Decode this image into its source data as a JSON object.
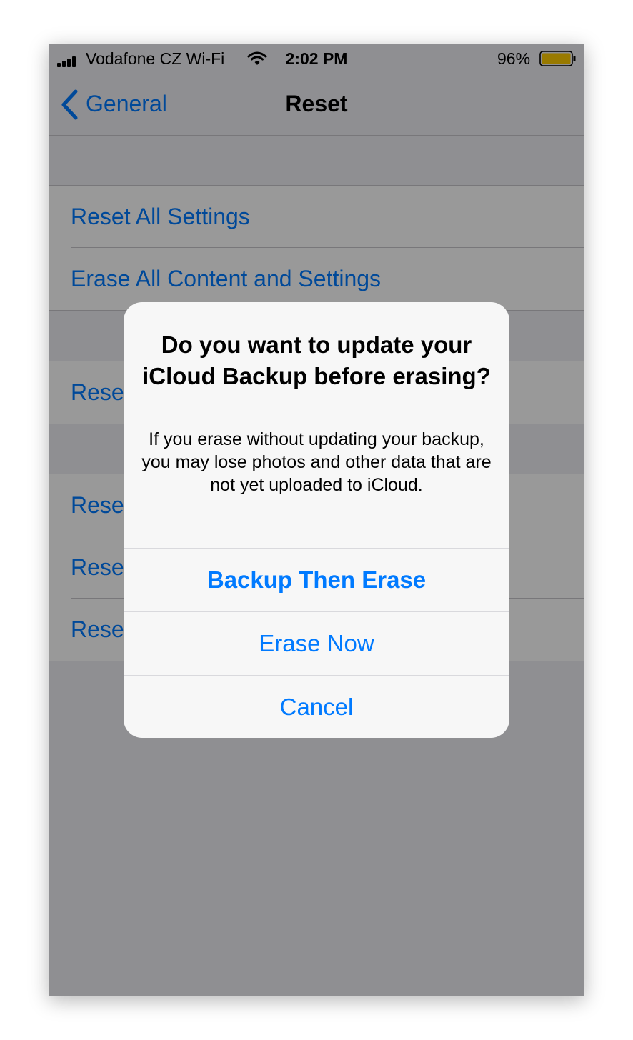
{
  "status_bar": {
    "carrier": "Vodafone CZ Wi-Fi",
    "time": "2:02 PM",
    "battery_percent": "96%",
    "signal_icon": "signal-bars-icon",
    "wifi_icon": "wifi-icon",
    "battery_icon": "battery-icon",
    "battery_color": "#ffcc00"
  },
  "nav": {
    "back_label": "General",
    "back_icon": "chevron-left-icon",
    "title": "Reset"
  },
  "list": {
    "group1": [
      "Reset All Settings",
      "Erase All Content and Settings"
    ],
    "group2": [
      "Rese"
    ],
    "group3": [
      "Rese",
      "Rese",
      "Rese"
    ]
  },
  "alert": {
    "title": "Do you want to update your iCloud Backup before erasing?",
    "message": "If you erase without updating your backup, you may lose photos and other data that are not yet uploaded to iCloud.",
    "buttons": {
      "backup_then_erase": "Backup Then Erase",
      "erase_now": "Erase Now",
      "cancel": "Cancel"
    }
  },
  "colors": {
    "accent": "#007aff",
    "background": "#efeff4",
    "overlay": "rgba(0,0,0,0.40)"
  }
}
